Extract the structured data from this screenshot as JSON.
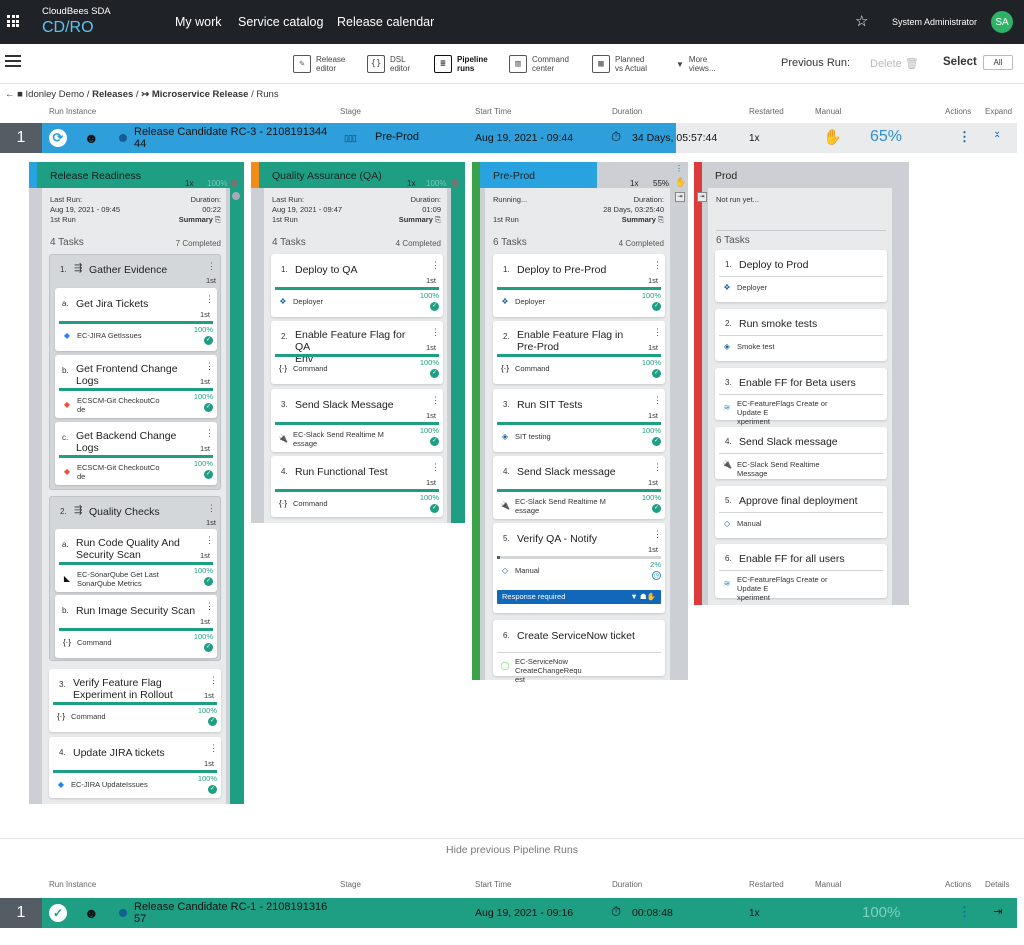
{
  "brand": {
    "company": "CloudBees SDA",
    "product": "CD/RO"
  },
  "nav": [
    "My work",
    "Service catalog",
    "Release calendar"
  ],
  "user": {
    "name": "System Administrator",
    "initials": "SA"
  },
  "toolbar": {
    "items": [
      [
        "Release",
        "editor"
      ],
      [
        "DSL",
        "editor"
      ],
      [
        "Pipeline",
        "runs"
      ],
      [
        "Command",
        "center"
      ],
      [
        "Planned",
        "vs Actual"
      ],
      [
        "More",
        "views..."
      ]
    ],
    "previous_run": "Previous Run:",
    "delete": "Delete",
    "select": "Select",
    "all": "All"
  },
  "breadcrumb": {
    "project": "Idonley Demo",
    "releases": "Releases",
    "release": "Microservice Release",
    "runs": "Runs"
  },
  "headers": {
    "run_instance": "Run Instance",
    "stage": "Stage",
    "start_time": "Start Time",
    "duration": "Duration",
    "restarted": "Restarted",
    "manual": "Manual",
    "actions": "Actions",
    "expand": "Expand",
    "details": "Details"
  },
  "run1": {
    "num": "1",
    "name": "Release Candidate RC-3 - 2108191344",
    "name2": "44",
    "stage": "Pre-Prod",
    "start": "Aug 19, 2021 - 09:44",
    "duration": "34 Days, 05:57:44",
    "restarted": "1x",
    "progress": "65%"
  },
  "run2": {
    "num": "1",
    "name": "Release Candidate RC-1 - 2108191316",
    "name2": "57",
    "start": "Aug 19, 2021 - 09:16",
    "duration": "00:08:48",
    "restarted": "1x",
    "progress": "100%"
  },
  "hide_runs": "Hide previous Pipeline Runs",
  "colors": {
    "topbar": "#1f2327",
    "accent": "#29a3e0",
    "success": "#1e9e83",
    "panel": "#ccd0d4",
    "prod": "#dc3b3b",
    "qa": "#f38b1b",
    "preprod": "#3aa247"
  },
  "stages": {
    "rr": {
      "name": "Release Readiness",
      "restart": "1x",
      "pct": "100%",
      "last_run_label": "Last Run:",
      "last_run": "Aug 19, 2021 - 09:45",
      "run_label": "1st Run",
      "duration_label": "Duration:",
      "duration": "00:22",
      "summary": "Summary",
      "tasks": "4 Tasks",
      "completed": "7 Completed",
      "g1": {
        "num": "1.",
        "title": "Gather Evidence",
        "first": "1st",
        "tasks": [
          {
            "num": "a.",
            "title": [
              "Get Jira Tickets"
            ],
            "first": "1st",
            "pct": "100%",
            "plugin": [
              "EC-JIRA GetIssues"
            ]
          },
          {
            "num": "b.",
            "title": [
              "Get Frontend Change",
              "Logs"
            ],
            "first": "1st",
            "pct": "100%",
            "plugin": [
              "ECSCM-Git CheckoutCo",
              "de"
            ]
          },
          {
            "num": "c.",
            "title": [
              "Get Backend Change",
              "Logs"
            ],
            "first": "1st",
            "pct": "100%",
            "plugin": [
              "ECSCM-Git CheckoutCo",
              "de"
            ]
          }
        ]
      },
      "g2": {
        "num": "2.",
        "title": "Quality Checks",
        "first": "1st",
        "tasks": [
          {
            "num": "a.",
            "title": [
              "Run Code Quality And",
              "Security Scan"
            ],
            "first": "1st",
            "pct": "100%",
            "plugin": [
              "EC-SonarQube Get Last",
              "SonarQube Metrics"
            ]
          },
          {
            "num": "b.",
            "title": [
              "Run Image Security Scan"
            ],
            "first": "1st",
            "pct": "100%",
            "plugin": [
              "Command"
            ]
          }
        ]
      },
      "t3": {
        "num": "3.",
        "title": [
          "Verify Feature Flag",
          "Experiment in Rollout"
        ],
        "first": "1st",
        "pct": "100%",
        "plugin": [
          "Command"
        ]
      },
      "t4": {
        "num": "4.",
        "title": [
          "Update JIRA tickets"
        ],
        "first": "1st",
        "pct": "100%",
        "plugin": [
          "EC-JIRA UpdateIssues"
        ]
      }
    },
    "qa": {
      "name": "Quality Assurance (QA)",
      "restart": "1x",
      "pct": "100%",
      "last_run_label": "Last Run:",
      "last_run": "Aug 19, 2021 - 09:47",
      "run_label": "1st Run",
      "duration_label": "Duration:",
      "duration": "01:09",
      "summary": "Summary",
      "tasks": "4 Tasks",
      "completed": "4 Completed",
      "items": [
        {
          "num": "1.",
          "title": [
            "Deploy to QA"
          ],
          "first": "1st",
          "pct": "100%",
          "plugin": [
            "Deployer"
          ]
        },
        {
          "num": "2.",
          "title": [
            "Enable Feature Flag for QA",
            "Env"
          ],
          "first": "1st",
          "pct": "100%",
          "plugin": [
            "Command"
          ]
        },
        {
          "num": "3.",
          "title": [
            "Send Slack Message"
          ],
          "first": "1st",
          "pct": "100%",
          "plugin": [
            "EC-Slack Send Realtime M",
            "essage"
          ]
        },
        {
          "num": "4.",
          "title": [
            "Run Functional Test"
          ],
          "first": "1st",
          "pct": "100%",
          "plugin": [
            "Command"
          ]
        }
      ]
    },
    "pp": {
      "name": "Pre-Prod",
      "restart": "1x",
      "pct": "55%",
      "status": "Running...",
      "run_label": "1st Run",
      "duration_label": "Duration:",
      "duration": "28 Days, 03:25:40",
      "summary": "Summary",
      "tasks": "6 Tasks",
      "completed": "4 Completed",
      "items": [
        {
          "num": "1.",
          "title": [
            "Deploy to Pre-Prod"
          ],
          "first": "1st",
          "pct": "100%",
          "plugin": [
            "Deployer"
          ]
        },
        {
          "num": "2.",
          "title": [
            "Enable Feature Flag in",
            "Pre-Prod"
          ],
          "first": "1st",
          "pct": "100%",
          "plugin": [
            "Command"
          ]
        },
        {
          "num": "3.",
          "title": [
            "Run SIT Tests"
          ],
          "first": "1st",
          "pct": "100%",
          "plugin": [
            "SIT testing"
          ]
        },
        {
          "num": "4.",
          "title": [
            "Send Slack message"
          ],
          "first": "1st",
          "pct": "100%",
          "plugin": [
            "EC-Slack Send Realtime M",
            "essage"
          ]
        },
        {
          "num": "5.",
          "title": [
            "Verify QA - Notify"
          ],
          "first": "1st",
          "pct": "2%",
          "plugin": [
            "Manual"
          ],
          "response": "Response required"
        },
        {
          "num": "6.",
          "title": [
            "Create ServiceNow ticket"
          ],
          "plugin": [
            "EC-ServiceNow CreateChangeRequ",
            "est"
          ]
        }
      ]
    },
    "prod": {
      "name": "Prod",
      "status": "Not run yet...",
      "tasks": "6 Tasks",
      "items": [
        {
          "num": "1.",
          "title": "Deploy to Prod",
          "plugin": [
            "Deployer"
          ]
        },
        {
          "num": "2.",
          "title": "Run smoke tests",
          "plugin": [
            "Smoke test"
          ]
        },
        {
          "num": "3.",
          "title": "Enable FF for Beta users",
          "plugin": [
            "EC-FeatureFlags Create or Update E",
            "xperiment"
          ]
        },
        {
          "num": "4.",
          "title": "Send Slack message",
          "plugin": [
            "EC-Slack Send Realtime Message"
          ]
        },
        {
          "num": "5.",
          "title": "Approve final deployment",
          "plugin": [
            "Manual"
          ]
        },
        {
          "num": "6.",
          "title": "Enable FF for all users",
          "plugin": [
            "EC-FeatureFlags Create or Update E",
            "xperiment"
          ]
        }
      ]
    }
  }
}
